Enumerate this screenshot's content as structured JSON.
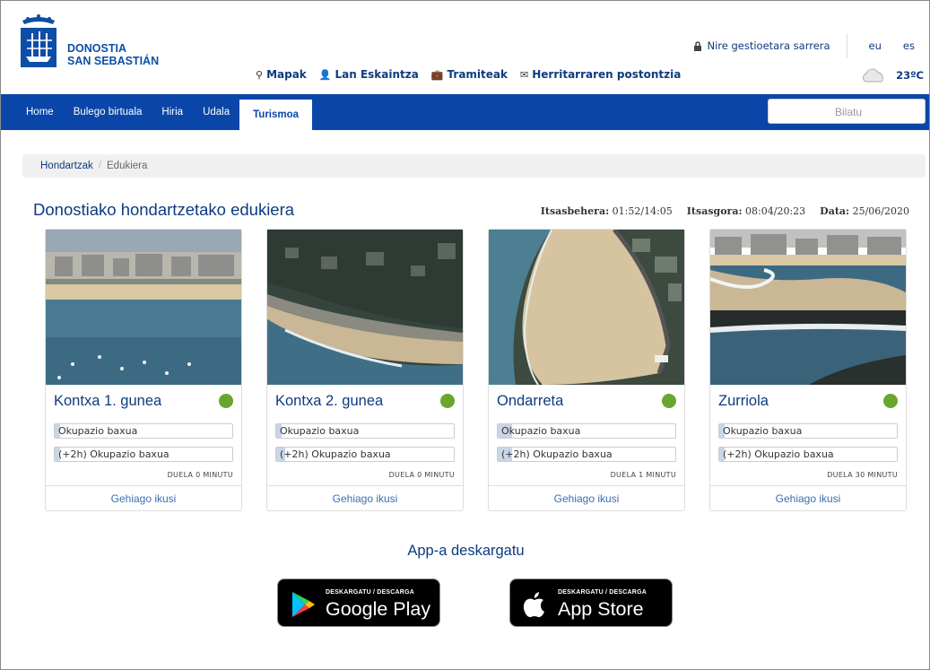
{
  "header": {
    "brand_line1": "DONOSTIA",
    "brand_line2": "SAN SEBASTIÁN",
    "nav_links": [
      {
        "label": "Mapak",
        "icon": "map-pin-icon"
      },
      {
        "label": "Lan Eskaintza",
        "icon": "user-icon"
      },
      {
        "label": "Tramiteak",
        "icon": "briefcase-icon"
      },
      {
        "label": "Herritarraren postontzia",
        "icon": "envelope-icon"
      }
    ],
    "login_label": "Nire gestioetara sarrera",
    "lang_eu": "eu",
    "lang_es": "es",
    "weather_temp": "23ºC"
  },
  "menu": {
    "items": [
      "Home",
      "Bulego birtuala",
      "Hiria",
      "Udala",
      "Turismoa"
    ],
    "active": "Turismoa",
    "search_placeholder": "Bilatu"
  },
  "breadcrumb": {
    "parent": "Hondartzak",
    "separator": "/",
    "current": "Edukiera"
  },
  "page": {
    "title": "Donostiako hondartzetako edukiera",
    "low_tide_label": "Itsasbehera:",
    "low_tide_value": "01:52/14:05",
    "high_tide_label": "Itsasgora:",
    "high_tide_value": "08:04/20:23",
    "date_label": "Data:",
    "date_value": "25/06/2020"
  },
  "beaches": [
    {
      "name": "Kontxa 1. gunea",
      "now_label": "Okupazio baxua",
      "now_level": 0.03,
      "later_label": "(+2h) Okupazio baxua",
      "later_level": 0.03,
      "ago": "DUELA 0 MINUTU",
      "more": "Gehiago ikusi",
      "status_color": "#6aa62e"
    },
    {
      "name": "Kontxa 2. gunea",
      "now_label": "Okupazio baxua",
      "now_level": 0.03,
      "later_label": "(+2h) Okupazio baxua",
      "later_level": 0.05,
      "ago": "DUELA 0 MINUTU",
      "more": "Gehiago ikusi",
      "status_color": "#6aa62e"
    },
    {
      "name": "Ondarreta",
      "now_label": "Okupazio baxua",
      "now_level": 0.08,
      "later_label": "(+2h) Okupazio baxua",
      "later_level": 0.08,
      "ago": "DUELA 1 MINUTU",
      "more": "Gehiago ikusi",
      "status_color": "#6aa62e"
    },
    {
      "name": "Zurriola",
      "now_label": "Okupazio baxua",
      "now_level": 0.03,
      "later_label": "(+2h) Okupazio baxua",
      "later_level": 0.03,
      "ago": "DUELA 30 MINUTU",
      "more": "Gehiago ikusi",
      "status_color": "#6aa62e"
    }
  ],
  "app": {
    "title": "App-a deskargatu",
    "google_small": "DESKARGATU / DESCARGA",
    "google_big": "Google Play",
    "apple_small": "DESKARGATU / DESCARGA",
    "apple_big": "App Store"
  },
  "colors": {
    "brand_blue": "#0a46a8",
    "status_green": "#6aa62e"
  }
}
